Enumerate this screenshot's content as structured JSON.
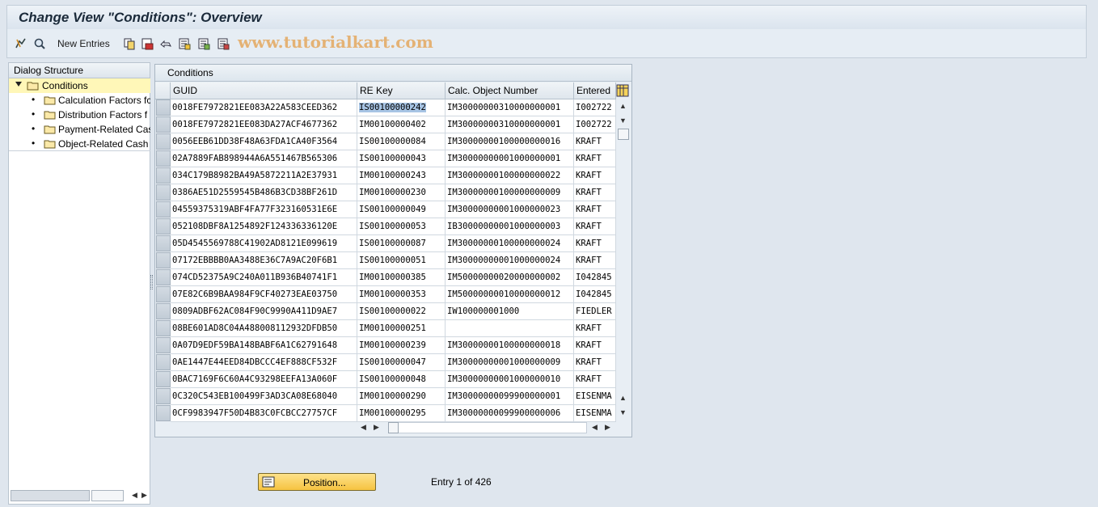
{
  "window": {
    "title": "Change View \"Conditions\": Overview"
  },
  "toolbar": {
    "new_entries_label": "New Entries",
    "watermark": "www.tutorialkart.com",
    "icons": [
      "display-change-icon",
      "find-icon",
      "copy-icon",
      "delete-icon",
      "undo-icon",
      "select-all-icon",
      "select-block-icon",
      "deselect-all-icon"
    ]
  },
  "dialog_structure": {
    "title": "Dialog Structure",
    "items": [
      {
        "label": "Conditions",
        "selected": true,
        "level": 0
      },
      {
        "label": "Calculation Factors fc",
        "level": 1
      },
      {
        "label": "Distribution Factors f",
        "level": 1
      },
      {
        "label": "Payment-Related Cas",
        "level": 1
      },
      {
        "label": "Object-Related Cash",
        "level": 1
      }
    ]
  },
  "table": {
    "caption": "Conditions",
    "columns": [
      "GUID",
      "RE Key",
      "Calc. Object Number",
      "Entered"
    ],
    "rows": [
      [
        "0018FE7972821EE083A22A583CEED362",
        "IS00100000242",
        "IM30000000310000000001",
        "I002722"
      ],
      [
        "0018FE7972821EE083DA27ACF4677362",
        "IM00100000402",
        "IM30000000310000000001",
        "I002722"
      ],
      [
        "0056EEB61DD38F48A63FDA1CA40F3564",
        "IS00100000084",
        "IM30000000100000000016",
        "KRAFT"
      ],
      [
        "02A7889FAB898944A6A551467B565306",
        "IS00100000043",
        "IM30000000001000000001",
        "KRAFT"
      ],
      [
        "034C179B8982BA49A5872211A2E37931",
        "IM00100000243",
        "IM30000000100000000022",
        "KRAFT"
      ],
      [
        "0386AE51D2559545B486B3CD38BF261D",
        "IM00100000230",
        "IM30000000100000000009",
        "KRAFT"
      ],
      [
        "04559375319ABF4FA77F323160531E6E",
        "IS00100000049",
        "IM30000000001000000023",
        "KRAFT"
      ],
      [
        "052108DBF8A1254892F124336336120E",
        "IS00100000053",
        "IB30000000001000000003",
        "KRAFT"
      ],
      [
        "05D4545569788C41902AD8121E099619",
        "IS00100000087",
        "IM30000000100000000024",
        "KRAFT"
      ],
      [
        "07172EBBBB0AA3488E36C7A9AC20F6B1",
        "IS00100000051",
        "IM30000000001000000024",
        "KRAFT"
      ],
      [
        "074CD52375A9C240A011B936B40741F1",
        "IM00100000385",
        "IM50000000020000000002",
        "I042845"
      ],
      [
        "07E82C6B9BAA984F9CF40273EAE03750",
        "IM00100000353",
        "IM50000000010000000012",
        "I042845"
      ],
      [
        "0809ADBF62AC084F90C9990A411D9AE7",
        "IS00100000022",
        "IW100000001000",
        "FIEDLER"
      ],
      [
        "08BE601AD8C04A488008112932DFDB50",
        "IM00100000251",
        "",
        "KRAFT"
      ],
      [
        "0A07D9EDF59BA148BABF6A1C62791648",
        "IM00100000239",
        "IM30000000100000000018",
        "KRAFT"
      ],
      [
        "0AE1447E44EED84DBCCC4EF888CF532F",
        "IS00100000047",
        "IM30000000001000000009",
        "KRAFT"
      ],
      [
        "0BAC7169F6C60A4C93298EEFA13A060F",
        "IS00100000048",
        "IM30000000001000000010",
        "KRAFT"
      ],
      [
        "0C320C543EB100499F3AD3CA08E68040",
        "IM00100000290",
        "IM30000000099900000001",
        "EISENMA"
      ],
      [
        "0CF9983947F50D4B83C0FCBCC27757CF",
        "IM00100000295",
        "IM30000000099900000006",
        "EISENMA"
      ]
    ]
  },
  "footer": {
    "position_label": "Position...",
    "entry_text": "Entry 1 of 426"
  },
  "colors": {
    "button_yellow": "#f6c341",
    "selection_yellow": "#fff7b8",
    "cell_highlight": "#a7c4e4"
  }
}
